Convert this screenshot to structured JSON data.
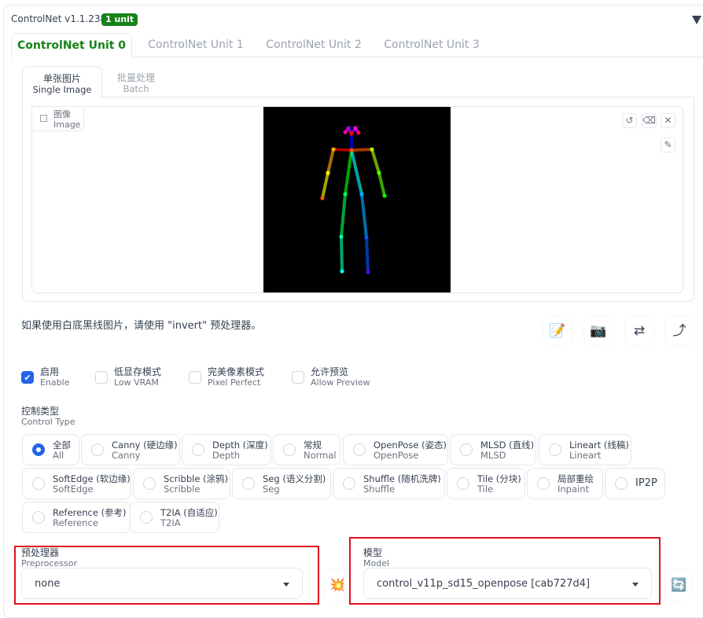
{
  "header": {
    "title": "ControlNet v1.1.238",
    "badge": "1 unit"
  },
  "unit_tabs": [
    {
      "label": "ControlNet Unit 0",
      "active": true
    },
    {
      "label": "ControlNet Unit 1",
      "active": false
    },
    {
      "label": "ControlNet Unit 2",
      "active": false
    },
    {
      "label": "ControlNet Unit 3",
      "active": false
    }
  ],
  "image_tabs": [
    {
      "zh": "单张图片",
      "en": "Single Image",
      "active": true
    },
    {
      "zh": "批量处理",
      "en": "Batch",
      "active": false
    }
  ],
  "image_panel": {
    "label_zh": "图像",
    "label_en": "Image",
    "tools": {
      "undo": "undo-icon",
      "erase": "eraser-icon",
      "close": "close-icon",
      "brush": "brush-icon"
    },
    "tool_glyphs": {
      "undo": "↺",
      "erase": "⌫",
      "close": "✕",
      "brush": "✎"
    },
    "pose_colors": {
      "head": "#0000ff",
      "shoulder_r": "#ff0000",
      "shoulder_l": "#ff5500",
      "upper_arm_r": "#ffaa00",
      "forearm_r": "#ffff00",
      "upper_arm_l": "#aaff00",
      "forearm_l": "#55ff00",
      "torso_r": "#00ff00",
      "thigh_r": "#00ff55",
      "shin_r": "#00ffaa",
      "torso_l": "#00ffff",
      "thigh_l": "#00aaff",
      "shin_l": "#0055ff",
      "face": "#aa00ff",
      "ears": "#ff00ff"
    }
  },
  "hint": "如果使用白底黑线图片，请使用 \"invert\" 预处理器。",
  "action_buttons": [
    {
      "name": "edit-icon",
      "glyph": "📝"
    },
    {
      "name": "camera-icon",
      "glyph": "📷"
    },
    {
      "name": "swap-icon",
      "glyph": "⇄"
    },
    {
      "name": "send-dimensions-icon",
      "glyph": "⤴"
    }
  ],
  "checkboxes": [
    {
      "zh": "启用",
      "en": "Enable",
      "checked": true
    },
    {
      "zh": "低显存模式",
      "en": "Low VRAM",
      "checked": false
    },
    {
      "zh": "完美像素模式",
      "en": "Pixel Perfect",
      "checked": false
    },
    {
      "zh": "允许预览",
      "en": "Allow Preview",
      "checked": false
    }
  ],
  "control_type": {
    "label_zh": "控制类型",
    "label_en": "Control Type",
    "selected": "All",
    "options": [
      {
        "zh": "全部",
        "en": "All",
        "checked": true
      },
      {
        "zh": "Canny (硬边缘)",
        "en": "Canny",
        "checked": false
      },
      {
        "zh": "Depth (深度)",
        "en": "Depth",
        "checked": false
      },
      {
        "zh": "常规",
        "en": "Normal",
        "checked": false
      },
      {
        "zh": "OpenPose (姿态)",
        "en": "OpenPose",
        "checked": false
      },
      {
        "zh": "MLSD (直线)",
        "en": "MLSD",
        "checked": false
      },
      {
        "zh": "Lineart (线稿)",
        "en": "Lineart",
        "checked": false
      },
      {
        "zh": "SoftEdge (软边缘)",
        "en": "SoftEdge",
        "checked": false
      },
      {
        "zh": "Scribble (涂鸦)",
        "en": "Scribble",
        "checked": false
      },
      {
        "zh": "Seg (语义分割)",
        "en": "Seg",
        "checked": false
      },
      {
        "zh": "Shuffle (随机洗牌)",
        "en": "Shuffle",
        "checked": false
      },
      {
        "zh": "Tile (分块)",
        "en": "Tile",
        "checked": false
      },
      {
        "zh": "局部重绘",
        "en": "Inpaint",
        "checked": false
      },
      {
        "zh": "IP2P",
        "en": "",
        "checked": false
      },
      {
        "zh": "Reference (参考)",
        "en": "Reference",
        "checked": false
      },
      {
        "zh": "T2IA (自适应)",
        "en": "T2IA",
        "checked": false
      }
    ]
  },
  "preprocessor": {
    "label_zh": "预处理器",
    "label_en": "Preprocessor",
    "value": "none",
    "run_glyph": "💥"
  },
  "model": {
    "label_zh": "模型",
    "label_en": "Model",
    "value": "control_v11p_sd15_openpose [cab727d4]",
    "refresh_glyph": "🔄"
  },
  "highlight_color": "#e0121f",
  "accent_color": "#16821a"
}
